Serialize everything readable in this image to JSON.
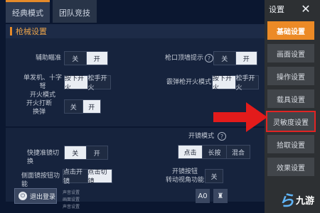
{
  "mode_tabs": [
    "经典模式",
    "团队竞技"
  ],
  "section_title": "枪械设置",
  "rows": {
    "assist_aim": {
      "label": "辅助瞄准",
      "options": [
        "关",
        "开"
      ]
    },
    "gun_switch_prompt": {
      "label": "枪口顶墙提示",
      "options": [
        "关",
        "开"
      ]
    },
    "single_fire": {
      "label": "单发机、十字弩\n开火模式",
      "options": [
        "按下开火",
        "松手开火"
      ]
    },
    "bolt_fire": {
      "label": "霰弹枪开火模式",
      "options": [
        "按下开火",
        "松手开火"
      ]
    },
    "fire_interrupt": {
      "label": "开火打断\n换弹",
      "options": [
        "关",
        "开"
      ]
    },
    "scope_mode": {
      "label": "开镜模式",
      "options": [
        "点击",
        "长按",
        "混合"
      ]
    },
    "quick_scope": {
      "label": "快捷准镜切换",
      "options": [
        "关",
        "开"
      ]
    },
    "side_scope": {
      "label": "侧面镜按钮功能",
      "options": [
        "点击开镜",
        "点击切镜"
      ]
    },
    "scope_button": {
      "label": "开镜按钮\n转动视角功能",
      "options": [
        "关"
      ]
    }
  },
  "help_icon": "?",
  "logout_label": "退出登录",
  "settings": {
    "title": "设置",
    "close": "✕",
    "menu": [
      "基础设置",
      "画面设置",
      "操作设置",
      "载具设置",
      "灵敏度设置",
      "拾取设置",
      "效果设置"
    ]
  },
  "footer": {
    "small_texts": [
      "声音设置",
      "画面设置",
      "声音设置"
    ],
    "icons": [
      "A0",
      "♜"
    ]
  },
  "brand": {
    "k": "ら",
    "text": "九游"
  },
  "colors": {
    "accent": "#ec8a26",
    "highlight": "#e02424"
  }
}
